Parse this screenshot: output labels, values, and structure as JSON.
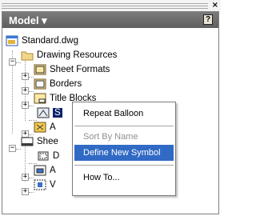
{
  "window": {
    "close_glyph": "×"
  },
  "panel": {
    "title": "Model ▾",
    "help": "?"
  },
  "tree": {
    "root": "Standard.dwg",
    "drawing_resources": "Drawing Resources",
    "sheet_formats": "Sheet Formats",
    "borders": "Borders",
    "title_blocks": "Title Blocks",
    "sketched_symbols_partial": "S",
    "item_a1": "A",
    "sheet_partial": "Shee",
    "child_d": "D",
    "child_a": "A",
    "child_v": "V"
  },
  "context_menu": {
    "items": [
      {
        "label": "Repeat Balloon",
        "enabled": true
      },
      {
        "label": "Sort By Name",
        "enabled": false
      },
      {
        "label": "Define New Symbol",
        "enabled": true,
        "highlighted": true
      },
      {
        "label": "How To...",
        "enabled": true
      }
    ]
  },
  "colors": {
    "header": "#6e6e6e",
    "highlight": "#316ac5",
    "folder": "#e8c979"
  }
}
